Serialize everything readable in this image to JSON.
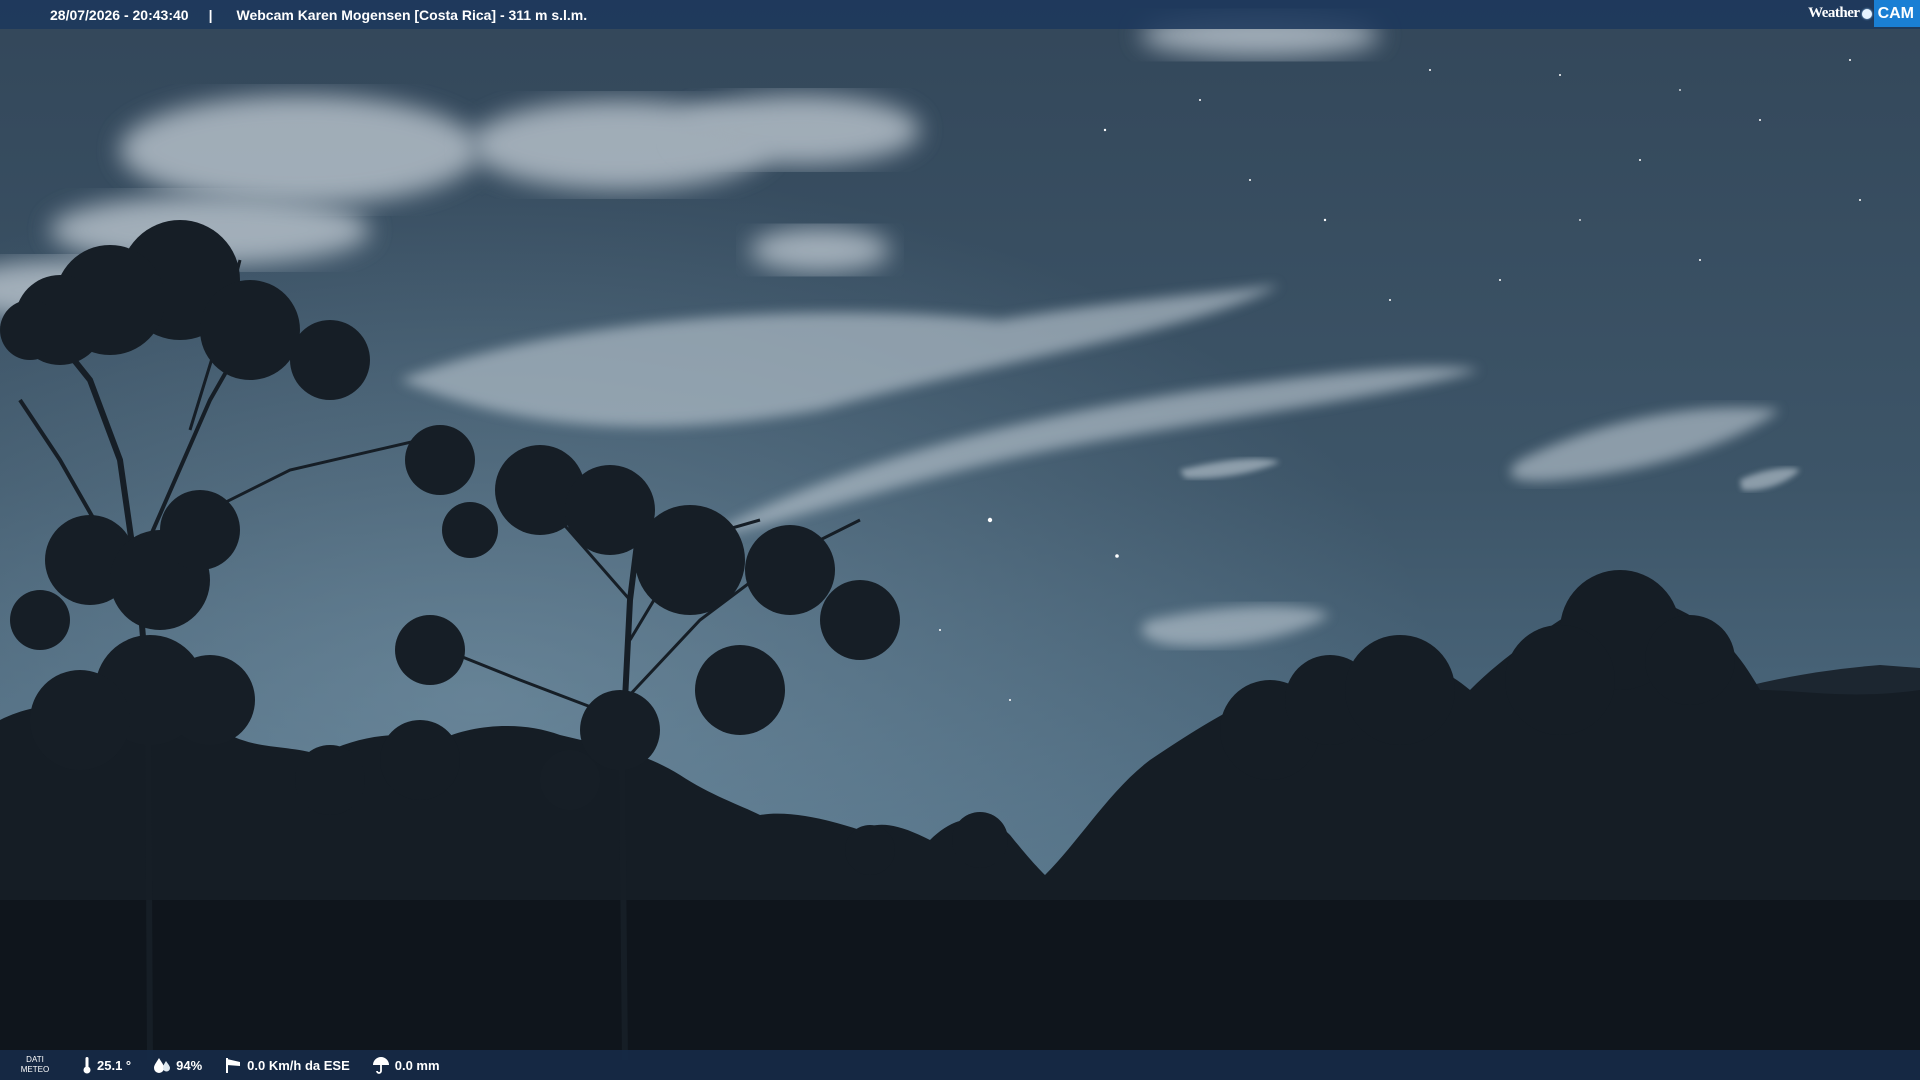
{
  "header": {
    "timestamp": "28/07/2026 - 20:43:40",
    "separator": "|",
    "title": "Webcam Karen Mogensen [Costa Rica]  - 311 m s.l.m."
  },
  "logo": {
    "weather": "Weather",
    "cam": "CAM"
  },
  "footer": {
    "dati_line1": "DATI",
    "dati_line2": "METEO",
    "temperature": "25.1 °",
    "humidity": "94%",
    "wind": "0.0 Km/h da ESE",
    "rain": "0.0 mm"
  },
  "icons": {
    "temperature": "thermometer-icon",
    "humidity": "humidity-drops-icon",
    "wind": "wind-sock-icon",
    "rain": "rain-umbrella-icon"
  }
}
